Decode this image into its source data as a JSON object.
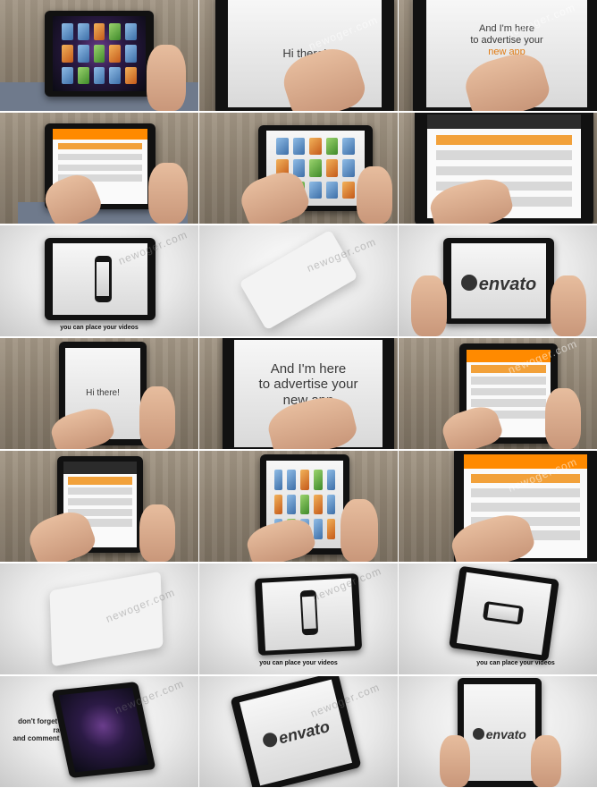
{
  "watermark": "newoger.com",
  "texts": {
    "hi_there": "Hi there!",
    "advertise_line1": "And I'm here",
    "advertise_line2": "to advertise your",
    "advertise_line3": "new app",
    "place_videos": "you can place your videos",
    "envato_logo": "envato",
    "rate_comment_line1": "don't forget to rate",
    "rate_comment_line2": "and comment :)"
  },
  "colors": {
    "accent": "#e07a12",
    "bezel": "#111111",
    "wood": "#8e8271"
  }
}
